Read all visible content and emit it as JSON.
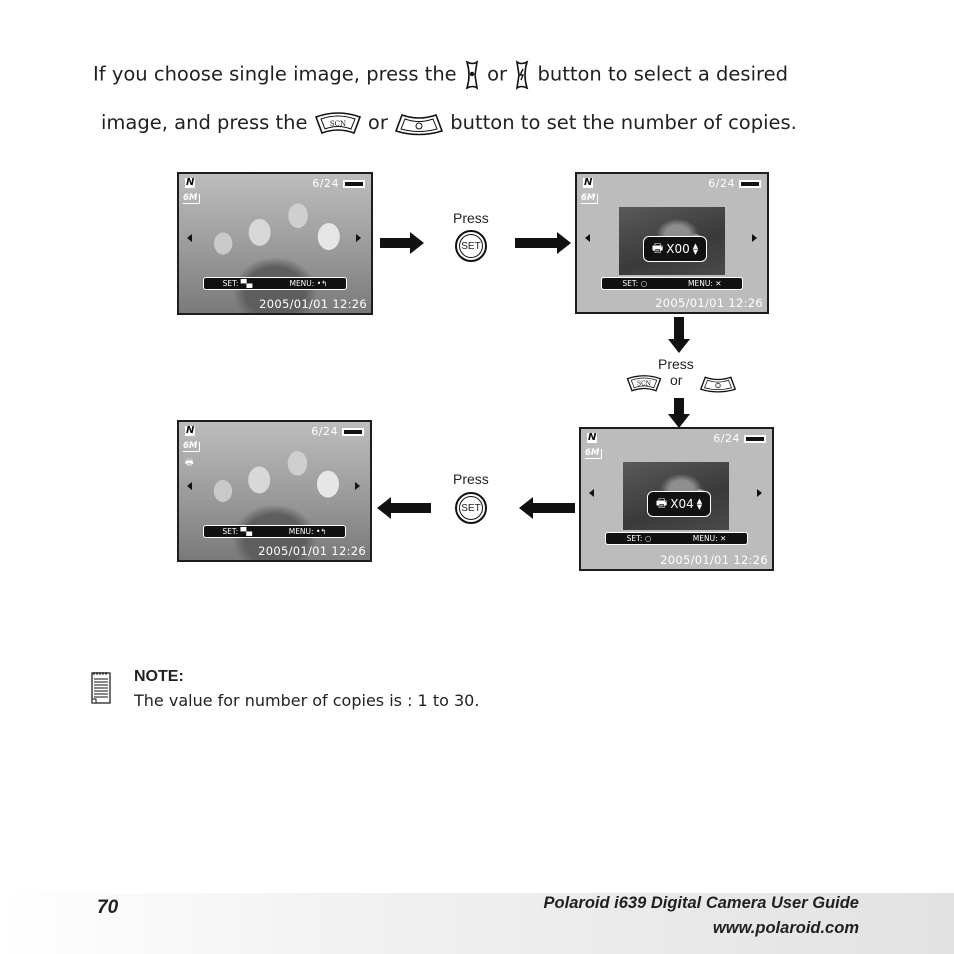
{
  "intro": {
    "line1_before": "If you choose single image, press the",
    "line1_or": "or",
    "line1_after": "button to select a desired",
    "line2_before": "image, and press  the",
    "line2_or": "or",
    "line2_after": "button to set the number of copies.",
    "icons": [
      "macro-left-button-icon",
      "flash-right-button-icon",
      "scn-up-button-icon",
      "self-timer-down-button-icon"
    ],
    "scn_label": "SCN"
  },
  "screens": [
    {
      "id": "screen-1",
      "counter": "6/24",
      "resolution": "6M",
      "bar_set": "SET:",
      "bar_menu": "MENU:",
      "date": "2005/01/01  12:26",
      "type": "photo"
    },
    {
      "id": "screen-2",
      "counter": "6/24",
      "resolution": "6M",
      "bar_set": "SET:",
      "bar_menu": "MENU:",
      "date": "2005/01/01  12:26",
      "copies": "X00",
      "type": "print-select"
    },
    {
      "id": "screen-3",
      "counter": "6/24",
      "resolution": "6M",
      "bar_set": "SET:",
      "bar_menu": "MENU:",
      "date": "2005/01/01  12:26",
      "copies": "X04",
      "type": "print-select"
    },
    {
      "id": "screen-4",
      "counter": "6/24",
      "resolution": "6M",
      "bar_set": "SET:",
      "bar_menu": "MENU:",
      "date": "2005/01/01  12:26",
      "type": "photo-marked"
    }
  ],
  "steps": {
    "press": "Press",
    "or": "or",
    "set": "SET",
    "scn": "SCN"
  },
  "note": {
    "title": "NOTE:",
    "text": "The  value for number of copies is : 1 to 30."
  },
  "footer": {
    "page_number": "70",
    "title": "Polaroid i639 Digital Camera User Guide",
    "url": "www.polaroid.com"
  }
}
